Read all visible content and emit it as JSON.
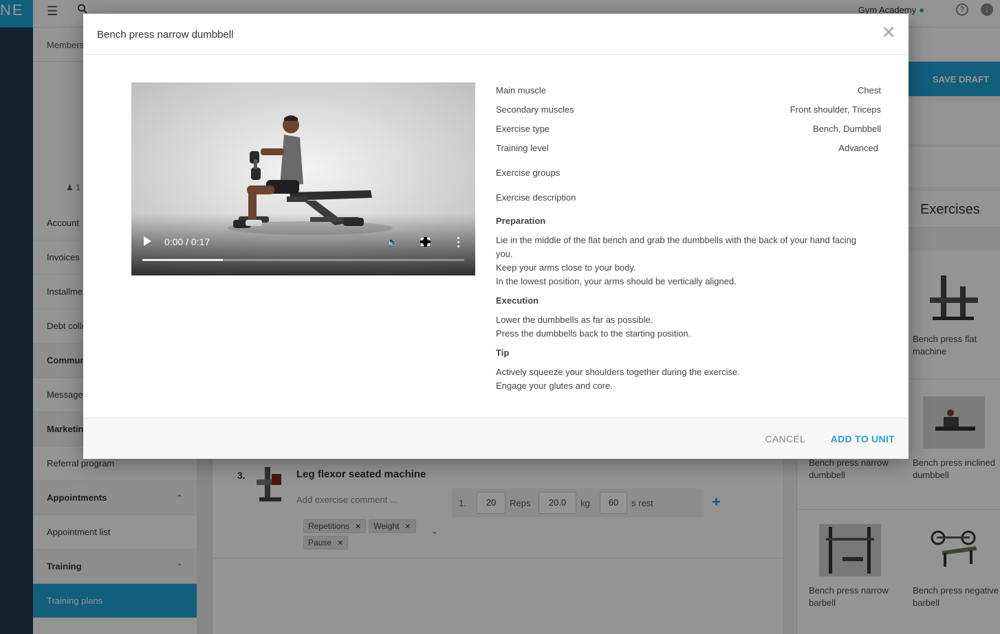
{
  "app": {
    "logo_fragment": "NE",
    "studio_name": "Gym Academy",
    "breadcrumb": "Members",
    "member_count": "1",
    "save_draft": "SAVE DRAFT"
  },
  "sidebar": {
    "items": [
      {
        "label": "Account",
        "type": "item"
      },
      {
        "label": "Invoices",
        "type": "item"
      },
      {
        "label": "Installme",
        "type": "item"
      },
      {
        "label": "Debt colle",
        "type": "item"
      },
      {
        "label": "Commun",
        "type": "section"
      },
      {
        "label": "Messages",
        "type": "item"
      },
      {
        "label": "Marketin",
        "type": "section"
      },
      {
        "label": "Referral program",
        "type": "item"
      },
      {
        "label": "Appointments",
        "type": "section"
      },
      {
        "label": "Appointment list",
        "type": "item"
      },
      {
        "label": "Training",
        "type": "section"
      },
      {
        "label": "Training plans",
        "type": "item"
      }
    ]
  },
  "plan": {
    "exercise": {
      "number": "3.",
      "title": "Leg flexor seated machine",
      "comment_placeholder": "Add exercise comment ...",
      "set_index": "1.",
      "reps": "20",
      "reps_unit": "Reps",
      "weight": "20.0",
      "weight_unit": "kg",
      "rest": "60",
      "rest_unit": "s rest",
      "tags": [
        "Repetitions",
        "Weight",
        "Pause"
      ]
    }
  },
  "exercises_panel": {
    "title": "Exercises",
    "cards": [
      {
        "name": "Bench press flat machine"
      },
      {
        "name": "Bench press narrow dumbbell"
      },
      {
        "name": "Bench press inclined dumbbell"
      },
      {
        "name": "Bench press narrow barbell"
      },
      {
        "name": "Bench press negative barbell"
      }
    ]
  },
  "modal": {
    "title": "Bench press narrow dumbbell",
    "video": {
      "time": "0:00 / 0:17",
      "progress": 0.25
    },
    "details": [
      {
        "label": "Main muscle",
        "value": "Chest"
      },
      {
        "label": "Secondary muscles",
        "value": "Front shoulder, Triceps"
      },
      {
        "label": "Exercise type",
        "value": "Bench, Dumbbell"
      },
      {
        "label": "Training level",
        "value": "Advanced"
      }
    ],
    "exercise_groups_label": "Exercise groups",
    "description_label": "Exercise description",
    "preparation": {
      "heading": "Preparation",
      "lines": [
        "Lie in the middle of the flat bench and grab the dumbbells with the back of your hand facing you.",
        "Keep your arms close to your body.",
        "In the lowest position, your arms should be vertically aligned."
      ]
    },
    "execution": {
      "heading": "Execution",
      "lines": [
        "Lower the dumbbells as far as possible.",
        "Press the dumbbells back to the starting position."
      ]
    },
    "tip": {
      "heading": "Tip",
      "lines": [
        "Actively squeeze your shoulders together during the exercise.",
        "Engage your glutes and core."
      ]
    },
    "cancel_label": "CANCEL",
    "add_label": "ADD TO UNIT"
  },
  "colors": {
    "accent": "#1ea2d8",
    "rail": "#20394a"
  },
  "icons": [
    "menu-icon",
    "search-icon",
    "location-pin-icon",
    "help-icon",
    "download-icon",
    "close-icon",
    "play-icon",
    "volume-icon",
    "fullscreen-icon",
    "more-vert-icon",
    "plus-icon",
    "chevron-up-icon",
    "chevron-down-icon",
    "person-icon"
  ]
}
